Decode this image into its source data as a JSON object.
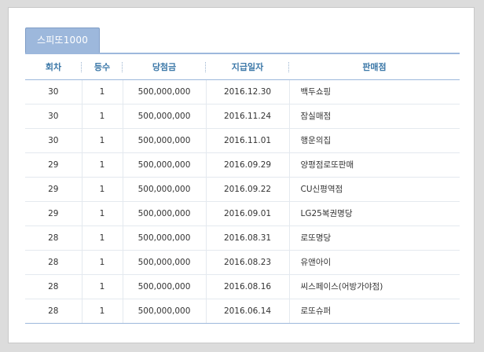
{
  "tab": {
    "label": "스피또1000"
  },
  "table": {
    "headers": {
      "round": "회차",
      "rank": "등수",
      "prize": "당첨금",
      "date": "지급일자",
      "store": "판매점"
    },
    "rows": [
      {
        "round": "30",
        "rank": "1",
        "prize": "500,000,000",
        "date": "2016.12.30",
        "store": "백두쇼핑"
      },
      {
        "round": "30",
        "rank": "1",
        "prize": "500,000,000",
        "date": "2016.11.24",
        "store": "잠실매점"
      },
      {
        "round": "30",
        "rank": "1",
        "prize": "500,000,000",
        "date": "2016.11.01",
        "store": "행운의집"
      },
      {
        "round": "29",
        "rank": "1",
        "prize": "500,000,000",
        "date": "2016.09.29",
        "store": "양평점로또판매"
      },
      {
        "round": "29",
        "rank": "1",
        "prize": "500,000,000",
        "date": "2016.09.22",
        "store": "CU신평역점"
      },
      {
        "round": "29",
        "rank": "1",
        "prize": "500,000,000",
        "date": "2016.09.01",
        "store": "LG25복권명당"
      },
      {
        "round": "28",
        "rank": "1",
        "prize": "500,000,000",
        "date": "2016.08.31",
        "store": "로또명당"
      },
      {
        "round": "28",
        "rank": "1",
        "prize": "500,000,000",
        "date": "2016.08.23",
        "store": "유앤아이"
      },
      {
        "round": "28",
        "rank": "1",
        "prize": "500,000,000",
        "date": "2016.08.16",
        "store": "씨스페이스(어방가야점)"
      },
      {
        "round": "28",
        "rank": "1",
        "prize": "500,000,000",
        "date": "2016.06.14",
        "store": "로또슈퍼"
      }
    ]
  }
}
